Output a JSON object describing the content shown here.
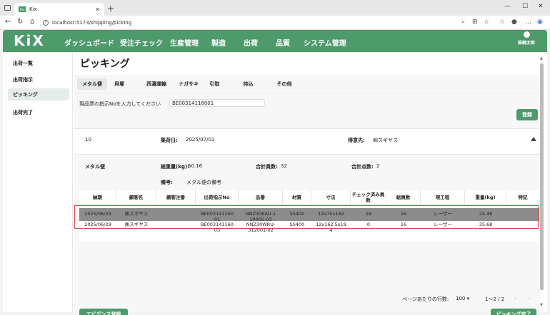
{
  "browser": {
    "tab_title": "Kix",
    "favicon_text": "Kix",
    "url": "localhost:5173/shipping/picking"
  },
  "app": {
    "logo": "KiX",
    "menu": [
      "ダッシュボード",
      "受注チェック",
      "生産管理",
      "製造",
      "出荷",
      "品質",
      "システム管理"
    ],
    "active_menu": "出荷",
    "user_name": "鉄鋼太郎"
  },
  "sidebar": {
    "items": [
      "出荷一覧",
      "出荷指示",
      "ピッキング",
      "出荷完了"
    ],
    "active": "ピッキング"
  },
  "page": {
    "title": "ピッキング",
    "tabs": [
      "メタル便",
      "貝塚",
      "西濃運輸",
      "ナガサキ",
      "引取",
      "持込",
      "その他"
    ],
    "active_tab": "メタル便"
  },
  "search": {
    "label": "現品票の指示Noを入力してください",
    "value": "BE00314116001",
    "register_button": "登録"
  },
  "info": {
    "id": "10",
    "shipping_date_label": "集荷日:",
    "shipping_date": "2025/07/01",
    "customer_label": "得意先:",
    "customer": "㈱スギヤス"
  },
  "detail": {
    "carrier": "メタル便",
    "total_weight_label": "総重量(kg):",
    "total_weight": "60.16",
    "total_count_label": "合計員数:",
    "total_count": "32",
    "total_points_label": "合計点数:",
    "total_points": "2",
    "remarks_label": "備考:",
    "remarks": "メタル便の備考"
  },
  "table": {
    "headers": [
      "納期",
      "顧客名",
      "顧客注番",
      "出荷指示No",
      "品番",
      "材質",
      "寸法",
      "チェック済み員数",
      "総員数",
      "現工程",
      "重量(kg)",
      "特記"
    ],
    "rows": [
      [
        "2025/06/29",
        "㈱スギヤス",
        "",
        "BE003141160\n01",
        "NNZ30KAU-1\n10005-02",
        "SS400",
        "12x75x162",
        "16",
        "16",
        "レーザー",
        "24.48",
        ""
      ],
      [
        "2025/06/29",
        "㈱スギヤス",
        "",
        "BE003141160\n03",
        "NNZ30WRU-\n312001-02",
        "SS400",
        "12x162.5x19\n4",
        "0",
        "16",
        "レーザー",
        "35.68",
        ""
      ]
    ]
  },
  "pager": {
    "rows_per_page_label": "ページあたりの行数:",
    "rows_per_page": "100",
    "range": "1～2 / 2"
  },
  "buttons": {
    "evidence": "エビデンス登録",
    "picking_done": "ピッキング完了"
  }
}
